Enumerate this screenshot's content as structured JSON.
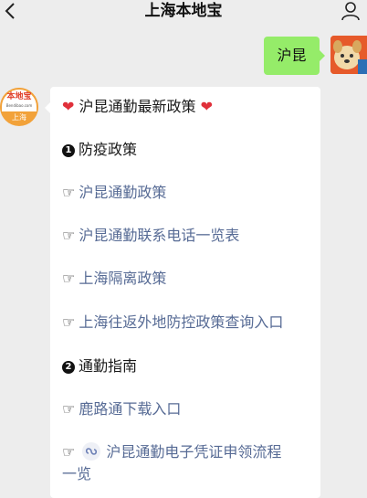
{
  "header": {
    "title": "上海本地宝"
  },
  "outgoing": {
    "text": "沪昆"
  },
  "bot": {
    "logo_text": "本地宝",
    "logo_url": "Bendibao.com",
    "logo_city": "上海"
  },
  "message": {
    "title_heart": "❤",
    "title": "沪昆通勤最新政策",
    "sections": [
      {
        "number": "1",
        "heading": "防疫政策",
        "links": [
          "沪昆通勤政策",
          "沪昆通勤联系电话一览表",
          "上海隔离政策",
          "上海往返外地防控政策查询入口"
        ]
      },
      {
        "number": "2",
        "heading": "通勤指南",
        "links": [
          "鹿路通下载入口",
          "沪昆通勤电子凭证申领流程",
          "一览"
        ]
      }
    ],
    "hand_glyph": "☞"
  },
  "colors": {
    "background": "#ededed",
    "outgoing_bubble": "#95ec69",
    "link": "#576b95",
    "heart": "#e0303a"
  },
  "icons": [
    "back-icon",
    "profile-icon",
    "hand-pointing-icon",
    "heart-icon",
    "mini-program-icon"
  ]
}
